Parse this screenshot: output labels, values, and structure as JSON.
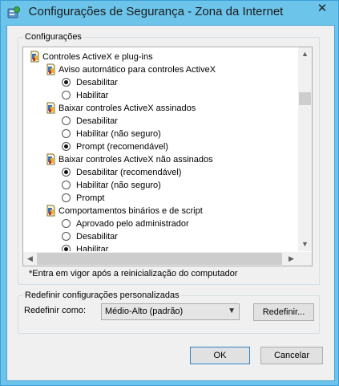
{
  "window": {
    "title": "Configurações de Segurança - Zona da Internet",
    "close_glyph": "✕"
  },
  "settings_group": {
    "title": "Configurações",
    "tree": [
      {
        "kind": "folder",
        "indent": 0,
        "label": "Controles ActiveX e plug-ins"
      },
      {
        "kind": "folder",
        "indent": 1,
        "label": "Aviso automático para controles ActiveX"
      },
      {
        "kind": "radio",
        "indent": 2,
        "label": "Desabilitar",
        "checked": true
      },
      {
        "kind": "radio",
        "indent": 2,
        "label": "Habilitar",
        "checked": false
      },
      {
        "kind": "folder",
        "indent": 1,
        "label": "Baixar controles ActiveX assinados"
      },
      {
        "kind": "radio",
        "indent": 2,
        "label": "Desabilitar",
        "checked": false
      },
      {
        "kind": "radio",
        "indent": 2,
        "label": "Habilitar (não seguro)",
        "checked": false
      },
      {
        "kind": "radio",
        "indent": 2,
        "label": "Prompt (recomendável)",
        "checked": true
      },
      {
        "kind": "folder",
        "indent": 1,
        "label": "Baixar controles ActiveX não assinados"
      },
      {
        "kind": "radio",
        "indent": 2,
        "label": "Desabilitar (recomendável)",
        "checked": true
      },
      {
        "kind": "radio",
        "indent": 2,
        "label": "Habilitar (não seguro)",
        "checked": false
      },
      {
        "kind": "radio",
        "indent": 2,
        "label": "Prompt",
        "checked": false
      },
      {
        "kind": "folder",
        "indent": 1,
        "label": "Comportamentos binários e de script"
      },
      {
        "kind": "radio",
        "indent": 2,
        "label": "Aprovado pelo administrador",
        "checked": false
      },
      {
        "kind": "radio",
        "indent": 2,
        "label": "Desabilitar",
        "checked": false
      },
      {
        "kind": "radio",
        "indent": 2,
        "label": "Habilitar",
        "checked": true
      }
    ],
    "note": "*Entra em vigor após a reinicialização do computador"
  },
  "reset_group": {
    "title": "Redefinir configurações personalizadas",
    "reset_to_label": "Redefinir como:",
    "selected_level": "Médio-Alto (padrão)",
    "reset_button": "Redefinir..."
  },
  "footer": {
    "ok_button": "OK",
    "cancel_button": "Cancelar"
  },
  "icons": {
    "app": "security-shield-icon",
    "folder": "settings-folder-icon",
    "scroll_up": "scroll-up-arrow-icon",
    "scroll_down": "scroll-down-arrow-icon",
    "scroll_left": "scroll-left-arrow-icon",
    "scroll_right": "scroll-right-arrow-icon",
    "dropdown": "chevron-down-icon"
  },
  "colors": {
    "title_bar": "#6cc4ea",
    "dialog_face": "#f0f0f0",
    "default_button_border": "#3c7fb1"
  }
}
